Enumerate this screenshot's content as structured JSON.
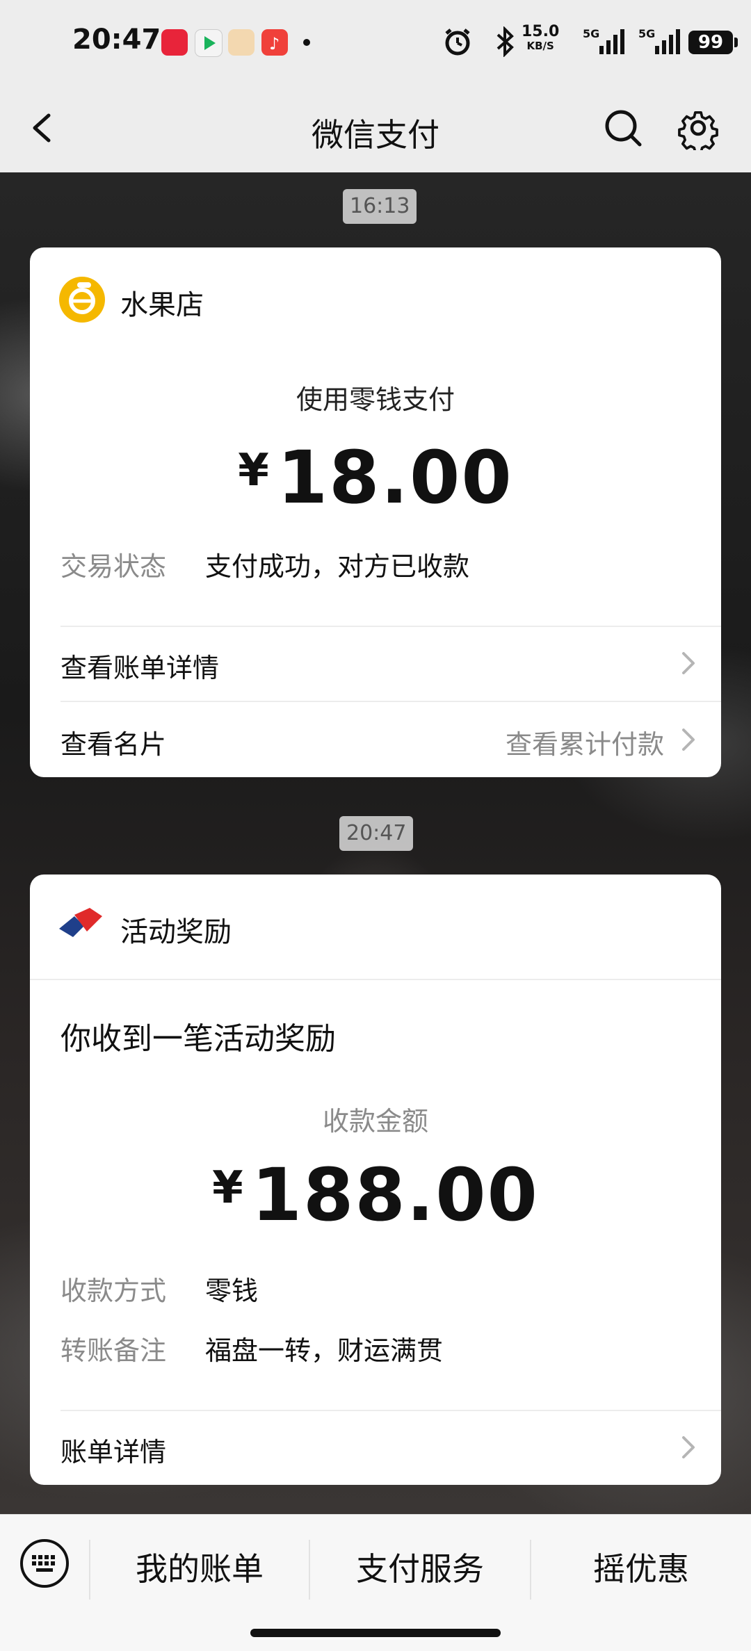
{
  "status_bar": {
    "time": "20:47",
    "net_speed": "15.0",
    "net_unit": "KB/S",
    "signal_1": "5G",
    "signal_2": "5G",
    "battery": "99"
  },
  "nav": {
    "title": "微信支付"
  },
  "messages": [
    {
      "timestamp": "16:13",
      "merchant": "水果店",
      "pay_method": "使用零钱支付",
      "currency": "¥",
      "amount": "18.00",
      "status_label": "交易状态",
      "status_value": "支付成功，对方已收款",
      "link_bill": "查看账单详情",
      "link_card": "查看名片",
      "link_total": "查看累计付款"
    },
    {
      "timestamp": "20:47",
      "title": "活动奖励",
      "headline": "你收到一笔活动奖励",
      "amount_label": "收款金额",
      "currency": "¥",
      "amount": "188.00",
      "method_label": "收款方式",
      "method_value": "零钱",
      "note_label": "转账备注",
      "note_value": "福盘一转，财运满贯",
      "link_bill": "账单详情"
    }
  ],
  "bottom_bar": {
    "tabs": [
      "我的账单",
      "支付服务",
      "摇优惠"
    ]
  }
}
